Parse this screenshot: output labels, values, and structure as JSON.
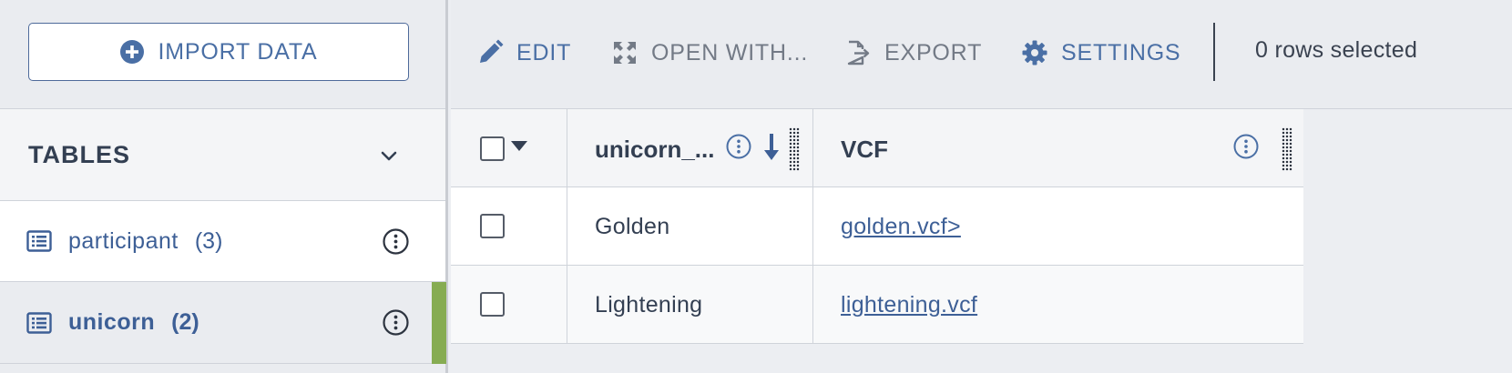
{
  "sidebar": {
    "import_label": "IMPORT DATA",
    "tables_title": "TABLES",
    "items": [
      {
        "name": "participant",
        "count": "(3)"
      },
      {
        "name": "unicorn",
        "count": "(2)"
      }
    ]
  },
  "toolbar": {
    "edit_label": "EDIT",
    "open_with_label": "OPEN WITH...",
    "export_label": "EXPORT",
    "settings_label": "SETTINGS",
    "rows_selected": "0 rows selected"
  },
  "grid": {
    "columns": [
      {
        "title": "unicorn_..."
      },
      {
        "title": "VCF"
      }
    ],
    "rows": [
      {
        "name": "Golden",
        "vcf": "golden.vcf>"
      },
      {
        "name": "Lightening",
        "vcf": "lightening.vcf"
      }
    ]
  },
  "colors": {
    "accent_blue": "#4a6fa5",
    "link_blue": "#3d5f96",
    "active_green": "#86ac52",
    "muted_gray": "#737a86"
  },
  "icons": {
    "import": "plus-circle-icon",
    "edit": "pencil-icon",
    "open_with": "expand-icon",
    "export": "export-icon",
    "settings": "gear-icon",
    "table": "list-icon",
    "menu": "kebab-menu-icon",
    "chevron": "chevron-down-icon",
    "sort": "arrow-down-icon"
  }
}
